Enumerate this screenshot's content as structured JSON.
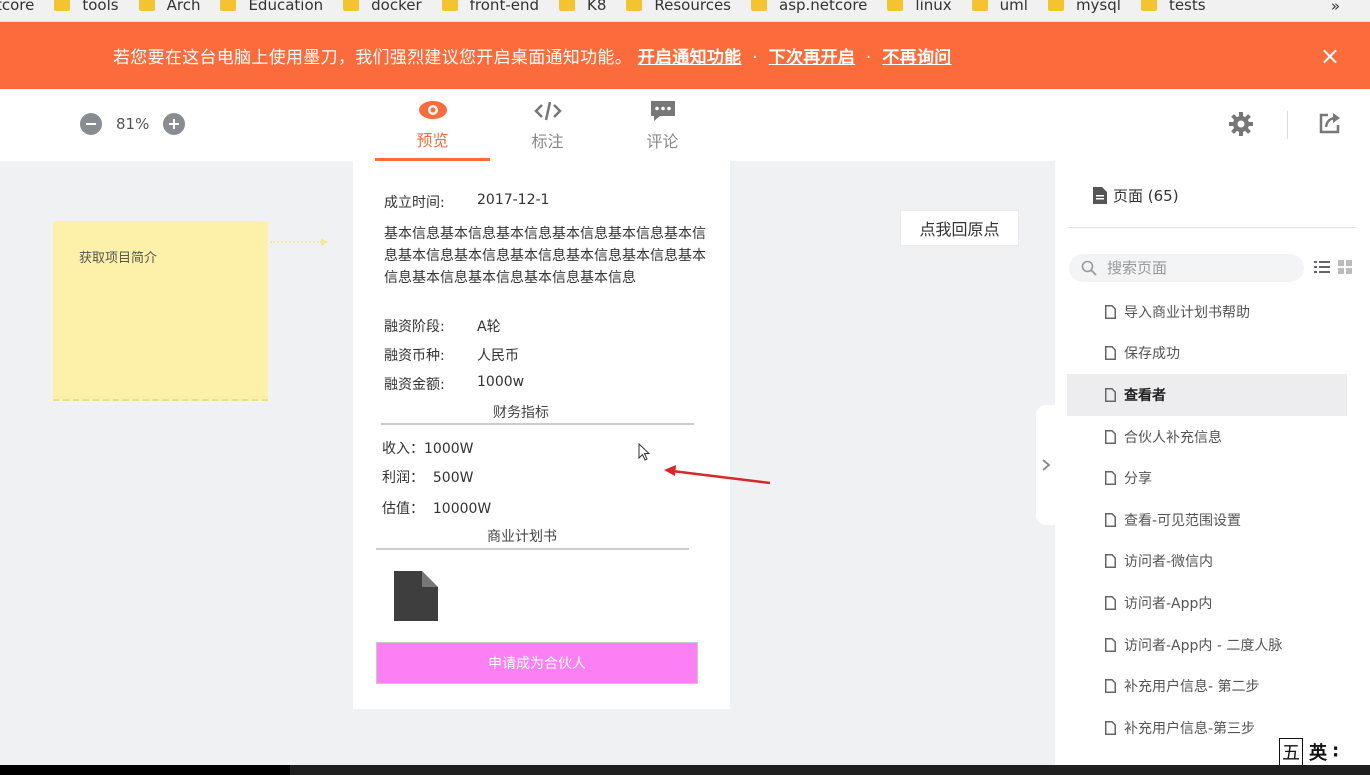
{
  "bookmarks": {
    "items": [
      "tcore",
      "tools",
      "Arch",
      "Education",
      "docker",
      "front-end",
      "K8",
      "Resources",
      "asp.netcore",
      "linux",
      "uml",
      "mysql",
      "tests"
    ],
    "more": "»"
  },
  "notification": {
    "message": "若您要在这台电脑上使用墨刀，我们强烈建议您开启桌面通知功能。",
    "enable": "开启通知功能",
    "later": "下次再开启",
    "never": "不再询问",
    "separator": "·",
    "close": "×",
    "bg_color": "#fb6b3c"
  },
  "toolbar": {
    "zoom_value": "81%",
    "tabs": [
      {
        "label": "预览",
        "icon": "eye-icon",
        "active": true
      },
      {
        "label": "标注",
        "icon": "code-icon",
        "active": false
      },
      {
        "label": "评论",
        "icon": "comment-icon",
        "active": false
      }
    ],
    "accent": "#fb6b3c"
  },
  "canvas": {
    "sticky_note": "获取项目简介",
    "home_button": "点我回原点",
    "phone": {
      "founded_label": "成立时间:",
      "founded_value": "2017-12-1",
      "description": "基本信息基本信息基本信息基本信息基本信息基本信息基本信息基本信息基本信息基本信息基本信息基本信息基本信息基本信息基本信息基本信息",
      "stage_label": "融资阶段:",
      "stage_value": "A轮",
      "currency_label": "融资币种:",
      "currency_value": "人民币",
      "amount_label": "融资金额:",
      "amount_value": "1000w",
      "finance_title": "财务指标",
      "income": "收入：1000W",
      "profit": "利润：  500W",
      "valuation": "估值：  10000W",
      "plan_title": "商业计划书",
      "apply_button": "申请成为合伙人",
      "apply_color": "#fd7ff4"
    }
  },
  "panel": {
    "title": "页面 (65)",
    "search_placeholder": "搜索页面",
    "pages": [
      {
        "label": "导入商业计划书帮助",
        "active": false
      },
      {
        "label": "保存成功",
        "active": false
      },
      {
        "label": "查看者",
        "active": true
      },
      {
        "label": "合伙人补充信息",
        "active": false
      },
      {
        "label": "分享",
        "active": false
      },
      {
        "label": "查看-可见范围设置",
        "active": false
      },
      {
        "label": "访问者-微信内",
        "active": false
      },
      {
        "label": "访问者-App内",
        "active": false
      },
      {
        "label": "访问者-App内 - 二度人脉",
        "active": false
      },
      {
        "label": "补充用户信息- 第二步",
        "active": false
      },
      {
        "label": "补充用户信息-第三步",
        "active": false
      }
    ]
  },
  "ime": {
    "mode1": "五",
    "mode2": "英",
    "extra": "∶"
  }
}
